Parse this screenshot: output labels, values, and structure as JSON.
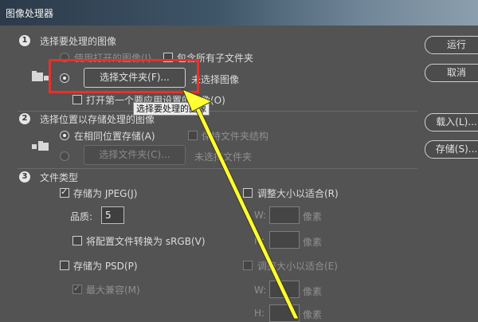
{
  "window": {
    "title": "图像处理器"
  },
  "section1": {
    "number": "1",
    "title": "选择要处理的图像",
    "use_open_images": "使用打开的图像(I)",
    "include_subfolders": "包含所有子文件夹",
    "select_folder_button": "选择文件夹(F)...",
    "no_images_selected": "未选择图像",
    "open_first_image": "打开第一个要应用设置的图像(O)",
    "tooltip": "选择要处理的图像"
  },
  "section2": {
    "number": "2",
    "title": "选择位置以存储处理的图像",
    "save_same_location": "在相同位置存储(A)",
    "keep_folder_structure": "保持文件夹结构",
    "select_folder_button": "选择文件夹(C)...",
    "no_folder_selected": "未选择文件夹"
  },
  "section3": {
    "number": "3",
    "title": "文件类型",
    "save_jpeg": "存储为 JPEG(J)",
    "resize_to_fit_r": "调整大小以适合(R)",
    "quality_label": "品质:",
    "quality_value": "5",
    "w_label": "W:",
    "h_label": "H:",
    "px_unit": "像素",
    "convert_srgb": "将配置文件转换为 sRGB(V)",
    "save_psd": "存储为 PSD(P)",
    "resize_to_fit_e": "调整大小以适合(E)",
    "max_compat": "最大兼容(M)"
  },
  "buttons": {
    "run": "运行",
    "cancel": "取消",
    "load": "载入(L)...",
    "save": "存储(S)..."
  },
  "colors": {
    "annotation_box": "#e8312b",
    "annotation_arrow": "#ffff33"
  }
}
